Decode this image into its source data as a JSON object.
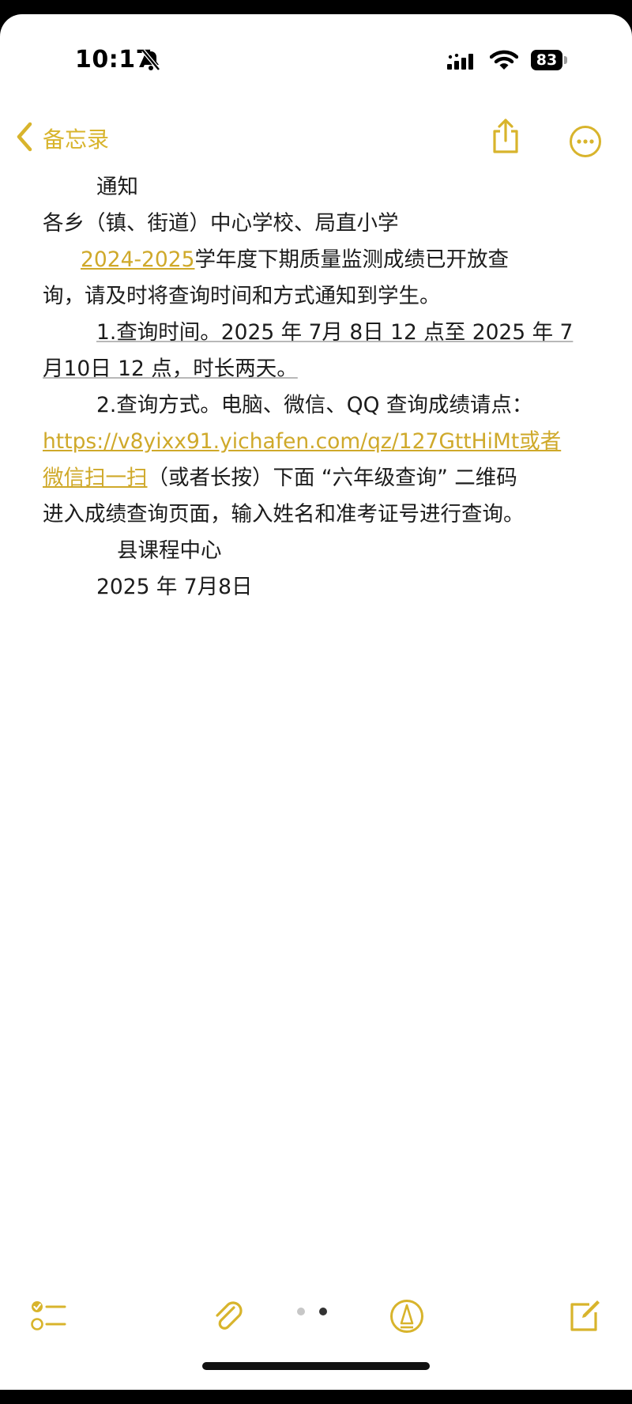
{
  "status": {
    "time": "10:17",
    "battery": "83"
  },
  "nav": {
    "back_label": "备忘录"
  },
  "note": {
    "title": "通知",
    "recipient": "各乡（镇、街道）中心学校、局直小学",
    "para1_year_link": "2024-2025",
    "para1_rest": "学年度下期质量监测成绩已开放查",
    "para1_line2": "询，请及时将查询时间和方式通知到学生。",
    "item1_line1": "1.查询时间。2025 年 7月 8日 12 点至 2025 年 7",
    "item1_line2": "月10日 12 点，时长两天。",
    "item2_line1": "2.查询方式。电脑、微信、QQ 查询成绩请点：",
    "item2_url": "https://v8yixx91.yichafen.com/qz/127GttHiMt或者",
    "item2_link2": "微信扫一扫",
    "item2_line3_rest": "（或者长按）下面 “六年级查询” 二维码",
    "item2_line4": "进入成绩查询页面，输入姓名和准考证号进行查询。",
    "signature": "县课程中心",
    "date": "2025 年 7月8日"
  },
  "colors": {
    "accent": "#d8b42c",
    "background": "#ffffff",
    "text": "#1c1c1c"
  },
  "icons": [
    "bell-slash-icon",
    "cellular-signal-icon",
    "wifi-icon",
    "battery-icon",
    "chevron-left-icon",
    "share-icon",
    "more-icon",
    "checklist-icon",
    "paperclip-icon",
    "markup-icon",
    "compose-icon"
  ]
}
